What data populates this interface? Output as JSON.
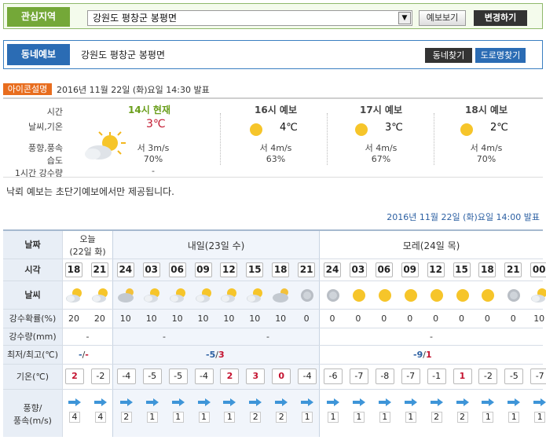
{
  "region": {
    "label": "관심지역",
    "selected": "강원도 평창군 봉평면",
    "view_btn": "예보보기",
    "change_btn": "변경하기"
  },
  "dong": {
    "label": "동네예보",
    "name": "강원도 평창군 봉평면",
    "find_btn": "동네찾기",
    "road_btn": "도로명찾기"
  },
  "announce": {
    "icon_btn": "아이콘설명",
    "text": "2016년 11월 22일 (화)요일 14:30 발표"
  },
  "current": {
    "row_labels": [
      "시간",
      "날씨,기온",
      "풍향,풍속",
      "습도",
      "1시간 강수량"
    ],
    "now": {
      "title": "14시 현재",
      "temp": "3℃",
      "wind": "서 3m/s",
      "humidity": "70%",
      "rain": "-"
    },
    "forecasts": [
      {
        "title": "16시 예보",
        "temp": "4℃",
        "wind": "서 4m/s",
        "humidity": "63%"
      },
      {
        "title": "17시 예보",
        "temp": "3℃",
        "wind": "서 4m/s",
        "humidity": "67%"
      },
      {
        "title": "18시 예보",
        "temp": "2℃",
        "wind": "서 4m/s",
        "humidity": "70%"
      }
    ]
  },
  "notice": "낙뢰 예보는 초단기예보에서만 제공됩니다.",
  "issued": "2016년 11월 22일 (화)요일 14:00 발표",
  "grid": {
    "headers": {
      "date": "날짜",
      "time": "시각",
      "weather": "날씨",
      "pop": "강수확률(%)",
      "rain": "강수량(mm)",
      "minmax": "최저/최고(℃)",
      "temp": "기온(℃)",
      "wind": "풍향/\n풍속(m/s)"
    },
    "days": {
      "today_line1": "오늘",
      "today_line2": "(22일 화)",
      "tomorrow": "내일(23일 수)",
      "dayafter": "모레(24일 목)"
    },
    "times": [
      "18",
      "21",
      "24",
      "03",
      "06",
      "09",
      "12",
      "15",
      "18",
      "21",
      "24",
      "03",
      "06",
      "09",
      "12",
      "15",
      "18",
      "21",
      "00"
    ],
    "pop": [
      "20",
      "20",
      "10",
      "10",
      "10",
      "10",
      "10",
      "10",
      "10",
      "0",
      "0",
      "0",
      "0",
      "0",
      "0",
      "0",
      "0",
      "0",
      "10"
    ],
    "rain": [
      "-",
      "-",
      "-",
      "-"
    ],
    "minmax": {
      "today": "-/-",
      "today_min": "-",
      "today_max": "-",
      "tmr_min": "-5",
      "tmr_max": "3",
      "dat_min": "-9",
      "dat_max": "1"
    },
    "temps": [
      "2",
      "-2",
      "-4",
      "-5",
      "-5",
      "-4",
      "2",
      "3",
      "0",
      "-4",
      "-6",
      "-7",
      "-8",
      "-7",
      "-1",
      "1",
      "-2",
      "-5",
      "-7"
    ],
    "warm": [
      true,
      false,
      false,
      false,
      false,
      false,
      true,
      true,
      true,
      false,
      false,
      false,
      false,
      false,
      false,
      true,
      false,
      false,
      false
    ],
    "winds": [
      "4",
      "4",
      "2",
      "1",
      "1",
      "1",
      "1",
      "2",
      "2",
      "1",
      "1",
      "1",
      "1",
      "1",
      "2",
      "2",
      "1",
      "1",
      "1"
    ],
    "weather": [
      "cloudy-sun",
      "cloudy-sun",
      "cloudy",
      "cloudy-sun",
      "cloudy-sun",
      "cloudy-sun",
      "cloudy-sun",
      "cloudy-sun",
      "cloudy",
      "overcast",
      "overcast",
      "sunny",
      "sunny",
      "sunny",
      "sunny",
      "sunny",
      "sunny",
      "overcast",
      "cloudy-sun"
    ]
  },
  "colors": {
    "green": "#74a838",
    "blue": "#2b6cb4",
    "orange": "#e86d1e",
    "red": "#c4122f"
  }
}
